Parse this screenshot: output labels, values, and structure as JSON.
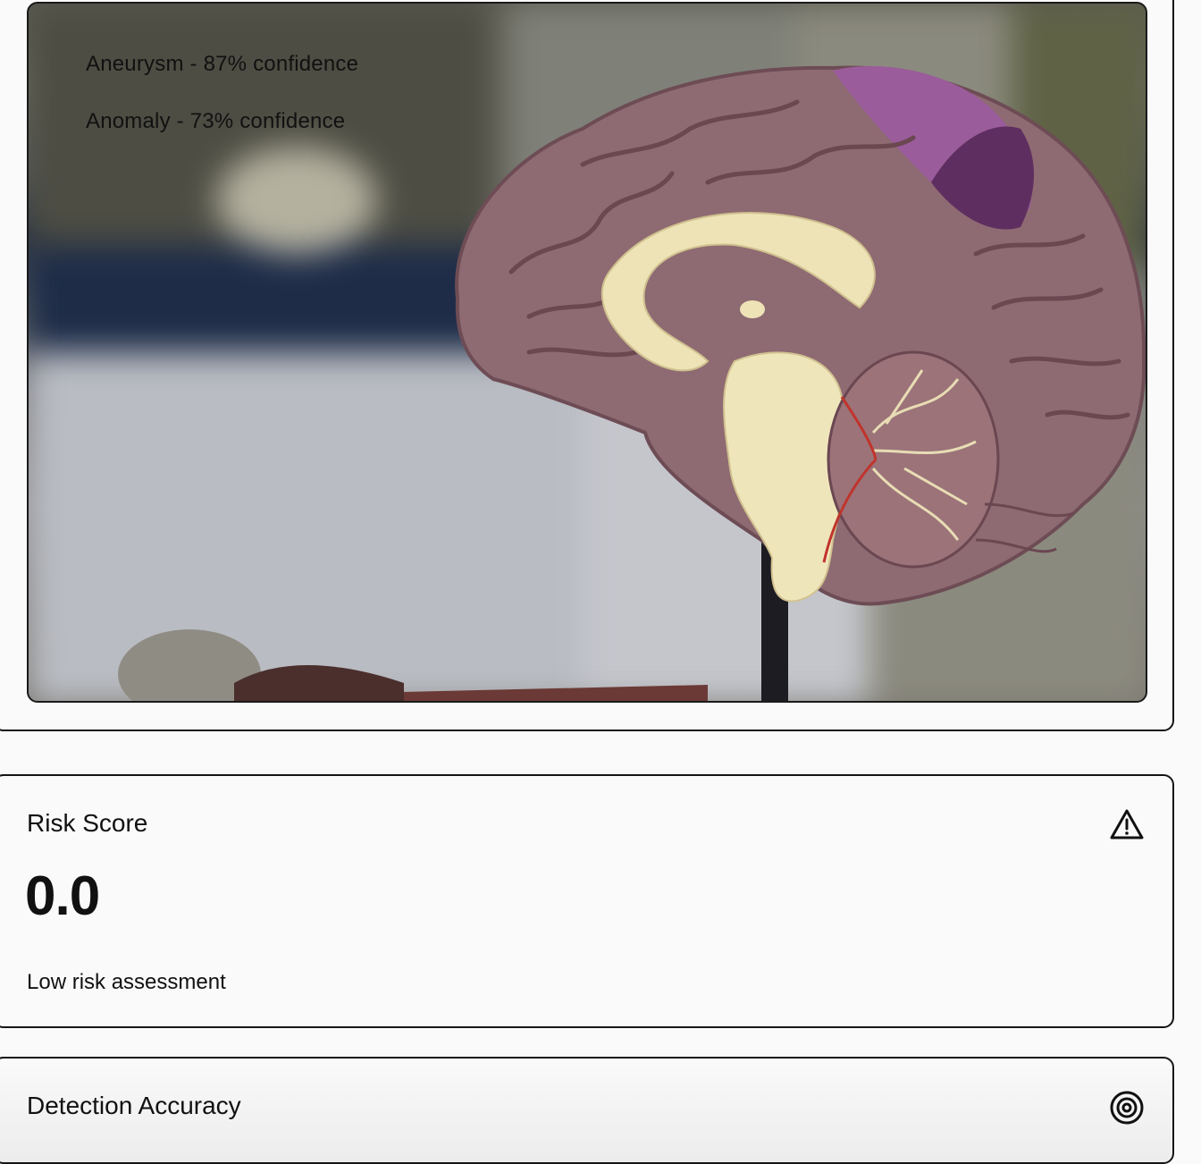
{
  "viewer": {
    "image_subject": "brain-model-photo",
    "detections": [
      "Aneurysm - 87% confidence",
      "Anomaly - 73% confidence"
    ]
  },
  "risk_card": {
    "title": "Risk Score",
    "icon": "warning-triangle-icon",
    "value": "0.0",
    "description": "Low risk assessment"
  },
  "accuracy_card": {
    "title": "Detection Accuracy",
    "icon": "target-icon"
  },
  "colors": {
    "border": "#151515",
    "background": "#fafafa",
    "text": "#111111"
  }
}
